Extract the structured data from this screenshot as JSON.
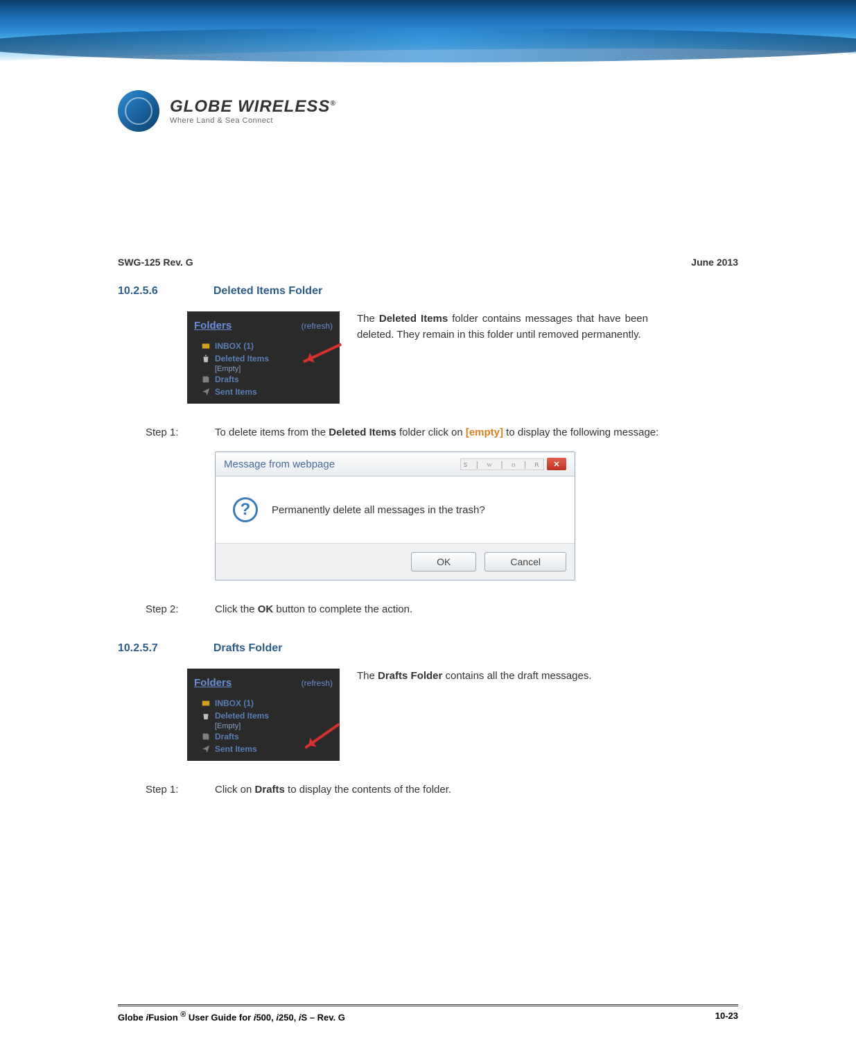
{
  "logo": {
    "main": "GLOBE WIRELESS",
    "reg": "®",
    "tagline": "Where Land & Sea Connect"
  },
  "doc_header": {
    "left": "SWG-125 Rev. G",
    "right": "June 2013"
  },
  "section1": {
    "number": "10.2.5.6",
    "title": "Deleted Items Folder",
    "folders_panel": {
      "title": "Folders",
      "refresh": "(refresh)",
      "items": [
        "INBOX (1)",
        "Deleted Items",
        "[Empty]",
        "Drafts",
        "Sent Items"
      ]
    },
    "description_pre": "The ",
    "description_bold": "Deleted Items",
    "description_post": " folder contains messages that have been deleted. They remain in this folder until removed permanently.",
    "step1": {
      "label": "Step  1:",
      "text_pre": "To delete items from the ",
      "text_bold": "Deleted Items",
      "text_mid": " folder click on ",
      "text_link": "[empty]",
      "text_post": " to display the following message:"
    },
    "dialog": {
      "title": "Message from webpage",
      "message": "Permanently delete all messages in the trash?",
      "ok": "OK",
      "cancel": "Cancel"
    },
    "step2": {
      "label": "Step  2:",
      "text_pre": "Click the ",
      "text_bold": "OK",
      "text_post": " button to complete the action."
    }
  },
  "section2": {
    "number": "10.2.5.7",
    "title": "Drafts Folder",
    "folders_panel": {
      "title": "Folders",
      "refresh": "(refresh)",
      "items": [
        "INBOX (1)",
        "Deleted Items",
        "[Empty]",
        "Drafts",
        "Sent Items"
      ]
    },
    "description_pre": "The ",
    "description_bold": "Drafts Folder",
    "description_post": " contains all the draft messages.",
    "step1": {
      "label": "Step  1:",
      "text_pre": "Click on ",
      "text_bold": "Drafts",
      "text_post": " to display the contents of the folder."
    }
  },
  "footer": {
    "left_pre": "Globe ",
    "left_i1": "i",
    "left_mid1": "Fusion ",
    "left_reg": "®",
    "left_mid2": " User Guide for ",
    "left_i2": "i",
    "left_n1": "500, ",
    "left_i3": "i",
    "left_n2": "250, ",
    "left_i4": "i",
    "left_n3": "S – Rev. G",
    "right": "10-23"
  }
}
